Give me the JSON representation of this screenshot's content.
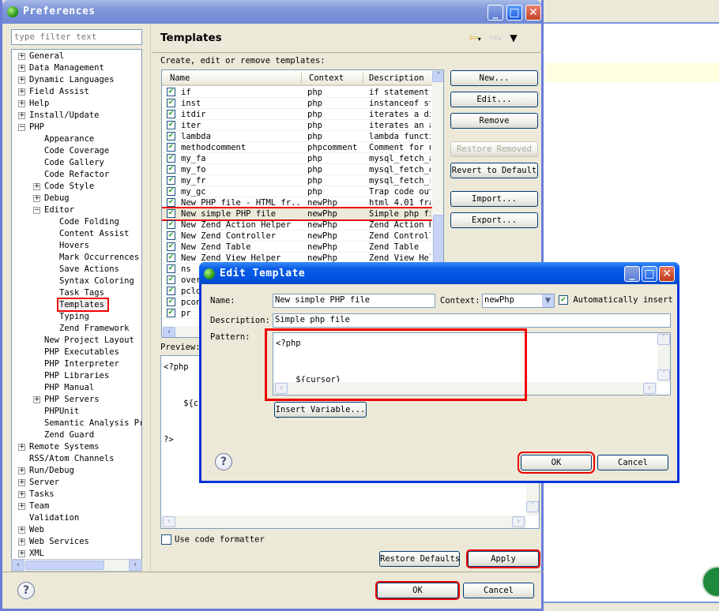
{
  "background_editor": {
    "visible": true
  },
  "preferences": {
    "title": "Preferences",
    "filter_placeholder": "type filter text",
    "tree": [
      {
        "label": "General",
        "level": 0,
        "expander": "+"
      },
      {
        "label": "Data Management",
        "level": 0,
        "expander": "+"
      },
      {
        "label": "Dynamic Languages",
        "level": 0,
        "expander": "+"
      },
      {
        "label": "Field Assist",
        "level": 0,
        "expander": "+"
      },
      {
        "label": "Help",
        "level": 0,
        "expander": "+"
      },
      {
        "label": "Install/Update",
        "level": 0,
        "expander": "+"
      },
      {
        "label": "PHP",
        "level": 0,
        "expander": "-"
      },
      {
        "label": "Appearance",
        "level": 1,
        "expander": ""
      },
      {
        "label": "Code Coverage",
        "level": 1,
        "expander": ""
      },
      {
        "label": "Code Gallery",
        "level": 1,
        "expander": ""
      },
      {
        "label": "Code Refactor",
        "level": 1,
        "expander": ""
      },
      {
        "label": "Code Style",
        "level": 1,
        "expander": "+"
      },
      {
        "label": "Debug",
        "level": 1,
        "expander": "+"
      },
      {
        "label": "Editor",
        "level": 1,
        "expander": "-"
      },
      {
        "label": "Code Folding",
        "level": 2,
        "expander": ""
      },
      {
        "label": "Content Assist",
        "level": 2,
        "expander": ""
      },
      {
        "label": "Hovers",
        "level": 2,
        "expander": ""
      },
      {
        "label": "Mark Occurrences",
        "level": 2,
        "expander": ""
      },
      {
        "label": "Save Actions",
        "level": 2,
        "expander": ""
      },
      {
        "label": "Syntax Coloring",
        "level": 2,
        "expander": ""
      },
      {
        "label": "Task Tags",
        "level": 2,
        "expander": ""
      },
      {
        "label": "Templates",
        "level": 2,
        "expander": "",
        "selected": true
      },
      {
        "label": "Typing",
        "level": 2,
        "expander": ""
      },
      {
        "label": "Zend Framework",
        "level": 2,
        "expander": ""
      },
      {
        "label": "New Project Layout",
        "level": 1,
        "expander": ""
      },
      {
        "label": "PHP Executables",
        "level": 1,
        "expander": ""
      },
      {
        "label": "PHP Interpreter",
        "level": 1,
        "expander": ""
      },
      {
        "label": "PHP Libraries",
        "level": 1,
        "expander": ""
      },
      {
        "label": "PHP Manual",
        "level": 1,
        "expander": ""
      },
      {
        "label": "PHP Servers",
        "level": 1,
        "expander": "+"
      },
      {
        "label": "PHPUnit",
        "level": 1,
        "expander": ""
      },
      {
        "label": "Semantic Analysis Pro",
        "level": 1,
        "expander": ""
      },
      {
        "label": "Zend Guard",
        "level": 1,
        "expander": ""
      },
      {
        "label": "Remote Systems",
        "level": 0,
        "expander": "+"
      },
      {
        "label": "RSS/Atom Channels",
        "level": 0,
        "expander": ""
      },
      {
        "label": "Run/Debug",
        "level": 0,
        "expander": "+"
      },
      {
        "label": "Server",
        "level": 0,
        "expander": "+"
      },
      {
        "label": "Tasks",
        "level": 0,
        "expander": "+"
      },
      {
        "label": "Team",
        "level": 0,
        "expander": "+"
      },
      {
        "label": "Validation",
        "level": 0,
        "expander": ""
      },
      {
        "label": "Web",
        "level": 0,
        "expander": "+"
      },
      {
        "label": "Web Services",
        "level": 0,
        "expander": "+"
      },
      {
        "label": "XML",
        "level": 0,
        "expander": "+"
      }
    ],
    "page_title": "Templates",
    "create_label": "Create, edit or remove templates:",
    "table": {
      "columns": [
        "Name",
        "Context",
        "Description"
      ],
      "rows": [
        {
          "checked": true,
          "name": "if",
          "context": "php",
          "description": "if statement"
        },
        {
          "checked": true,
          "name": "inst",
          "context": "php",
          "description": "instanceof st"
        },
        {
          "checked": true,
          "name": "itdir",
          "context": "php",
          "description": "iterates a di"
        },
        {
          "checked": true,
          "name": "iter",
          "context": "php",
          "description": "iterates an a"
        },
        {
          "checked": true,
          "name": "lambda",
          "context": "php",
          "description": "lambda functi"
        },
        {
          "checked": true,
          "name": "methodcomment",
          "context": "phpcomment",
          "description": "Comment for n"
        },
        {
          "checked": true,
          "name": "my_fa",
          "context": "php",
          "description": "mysql_fetch_a"
        },
        {
          "checked": true,
          "name": "my_fo",
          "context": "php",
          "description": "mysql_fetch_o"
        },
        {
          "checked": true,
          "name": "my_fr",
          "context": "php",
          "description": "mysql_fetch_r"
        },
        {
          "checked": true,
          "name": "my_gc",
          "context": "php",
          "description": "Trap code out"
        },
        {
          "checked": true,
          "name": "New PHP file - HTML fr...",
          "context": "newPhp",
          "description": "html 4.01 fra"
        },
        {
          "checked": true,
          "name": "New simple PHP file",
          "context": "newPhp",
          "description": "Simple php fi",
          "selected": true
        },
        {
          "checked": true,
          "name": "New Zend Action Helper",
          "context": "newPhp",
          "description": "Zend Action H"
        },
        {
          "checked": true,
          "name": "New Zend Controller",
          "context": "newPhp",
          "description": "Zend Controll"
        },
        {
          "checked": true,
          "name": "New Zend Table",
          "context": "newPhp",
          "description": "Zend Table"
        },
        {
          "checked": true,
          "name": "New Zend View Helper",
          "context": "newPhp",
          "description": "Zend View Hel"
        },
        {
          "checked": true,
          "name": "ns",
          "context": "",
          "description": ""
        },
        {
          "checked": true,
          "name": "overr",
          "context": "",
          "description": ""
        },
        {
          "checked": true,
          "name": "pclon",
          "context": "",
          "description": ""
        },
        {
          "checked": true,
          "name": "pcon",
          "context": "",
          "description": ""
        },
        {
          "checked": true,
          "name": "pr",
          "context": "",
          "description": ""
        }
      ]
    },
    "buttons": {
      "new": "New...",
      "edit": "Edit...",
      "remove": "Remove",
      "restore_removed": "Restore Removed",
      "revert": "Revert to Default",
      "import": "Import...",
      "export": "Export...",
      "restore_defaults": "Restore Defaults",
      "apply": "Apply",
      "ok": "OK",
      "cancel": "Cancel"
    },
    "preview_label": "Preview:",
    "preview_text": "<?php\n\n    ${cu\n\n?>",
    "use_code_formatter": {
      "label": "Use code formatter",
      "checked": false
    }
  },
  "edit_template": {
    "title": "Edit Template",
    "name_label": "Name:",
    "name_value": "New simple PHP file",
    "context_label": "Context:",
    "context_value": "newPhp",
    "auto_insert_label": "Automatically insert",
    "auto_insert_checked": true,
    "description_label": "Description:",
    "description_value": "Simple php file",
    "pattern_label": "Pattern:",
    "pattern_value": "<?php\n\n    ${cursor}\n\n?>",
    "insert_variable": "Insert Variable...",
    "ok": "OK",
    "cancel": "Cancel"
  }
}
